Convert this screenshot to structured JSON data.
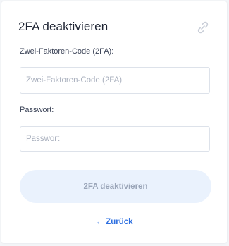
{
  "form": {
    "title": "2FA deaktivieren",
    "code_label": "Zwei-Faktoren-Code (2FA):",
    "code_placeholder": "Zwei-Faktoren-Code (2FA)",
    "password_label": "Passwort:",
    "password_placeholder": "Passwort",
    "submit_label": "2FA deaktivieren",
    "back_label": "← Zurück"
  },
  "icons": {
    "header_icon": "unlink-icon"
  },
  "colors": {
    "link": "#2d6fe0",
    "button_bg": "#eaf2fd",
    "button_text": "#9aa5b8"
  }
}
